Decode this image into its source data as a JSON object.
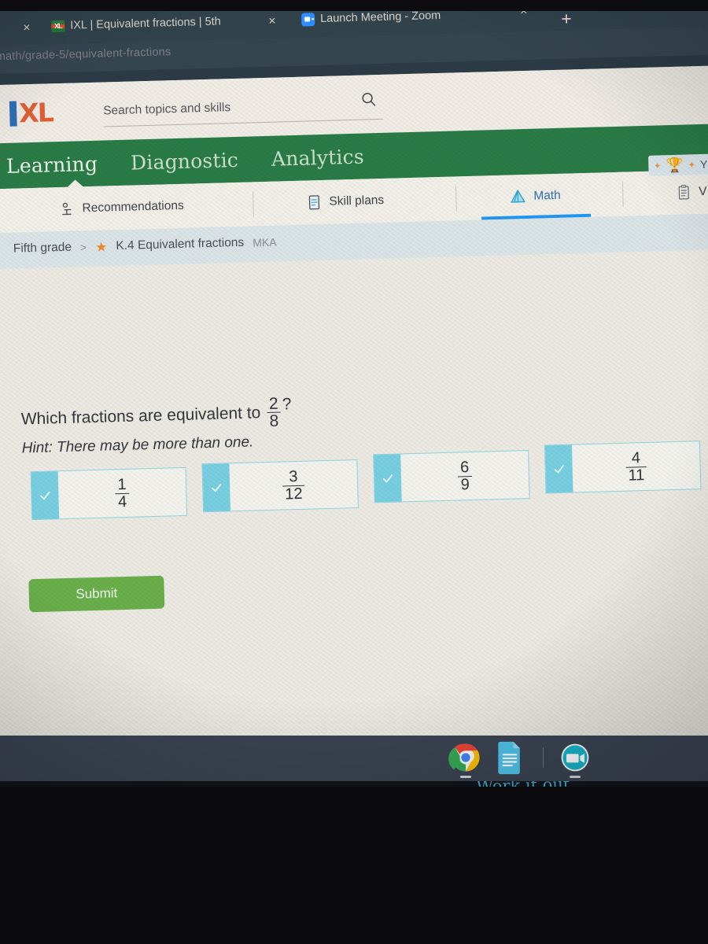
{
  "browser": {
    "tabs": [
      {
        "title": "IXL | Equivalent fractions | 5th",
        "favicon": "ixl-favicon",
        "close_label": "×"
      },
      {
        "title": "Launch Meeting - Zoom",
        "favicon": "zoom-favicon",
        "close_label": "×"
      }
    ],
    "tab_close_left": "×",
    "new_tab_label": "+",
    "url_prefix": "n",
    "url": "math/grade-5/equivalent-fractions"
  },
  "header": {
    "logo_i": "I",
    "logo_xl": "XL",
    "search_placeholder": "Search topics and skills",
    "search_value": "",
    "search_icon": "search-icon"
  },
  "greenbar": {
    "items": [
      {
        "label": "Learning",
        "active": true
      },
      {
        "label": "Diagnostic",
        "active": false
      },
      {
        "label": "Analytics",
        "active": false
      }
    ]
  },
  "subnav": {
    "items": [
      {
        "label": "Recommendations",
        "icon": "recommendations-icon",
        "active": false
      },
      {
        "label": "Skill plans",
        "icon": "skill-plans-icon",
        "active": false
      },
      {
        "label": "Math",
        "icon": "math-pyramid-icon",
        "active": true
      },
      {
        "label": "V",
        "icon": "clipboard-icon",
        "active": false
      }
    ]
  },
  "breadcrumb": {
    "grade": "Fifth grade",
    "separator": ">",
    "star_icon": "star-icon",
    "skill": "K.4 Equivalent fractions",
    "code": "MKA"
  },
  "award_chip": {
    "trophy_icon": "trophy-icon",
    "label": "Y"
  },
  "question": {
    "prefix": "Which fractions are equivalent to",
    "fraction_numerator": "2",
    "fraction_denominator": "8",
    "suffix": "?",
    "hint": "Hint: There may be more than one."
  },
  "choices": [
    {
      "numerator": "1",
      "denominator": "4",
      "checked": false
    },
    {
      "numerator": "3",
      "denominator": "12",
      "checked": false
    },
    {
      "numerator": "6",
      "denominator": "9",
      "checked": false
    },
    {
      "numerator": "4",
      "denominator": "11",
      "checked": false
    }
  ],
  "submit": {
    "label": "Submit"
  },
  "work_it_out": {
    "label": "Work it out"
  },
  "shelf": {
    "items": [
      {
        "name": "chrome-icon",
        "label": "Chrome"
      },
      {
        "name": "google-docs-icon",
        "label": "Docs"
      },
      {
        "name": "zoom-icon",
        "label": "Zoom"
      }
    ]
  },
  "colors": {
    "green_nav": "#2a7b46",
    "accent_blue": "#2196f3",
    "choice_teal": "#79cfdf",
    "submit_green": "#6aaf4a",
    "logo_orange": "#e35f33",
    "logo_blue": "#2f6fb5",
    "star_orange": "#f08a2c",
    "work_it_out_teal": "#3fa9c4"
  }
}
